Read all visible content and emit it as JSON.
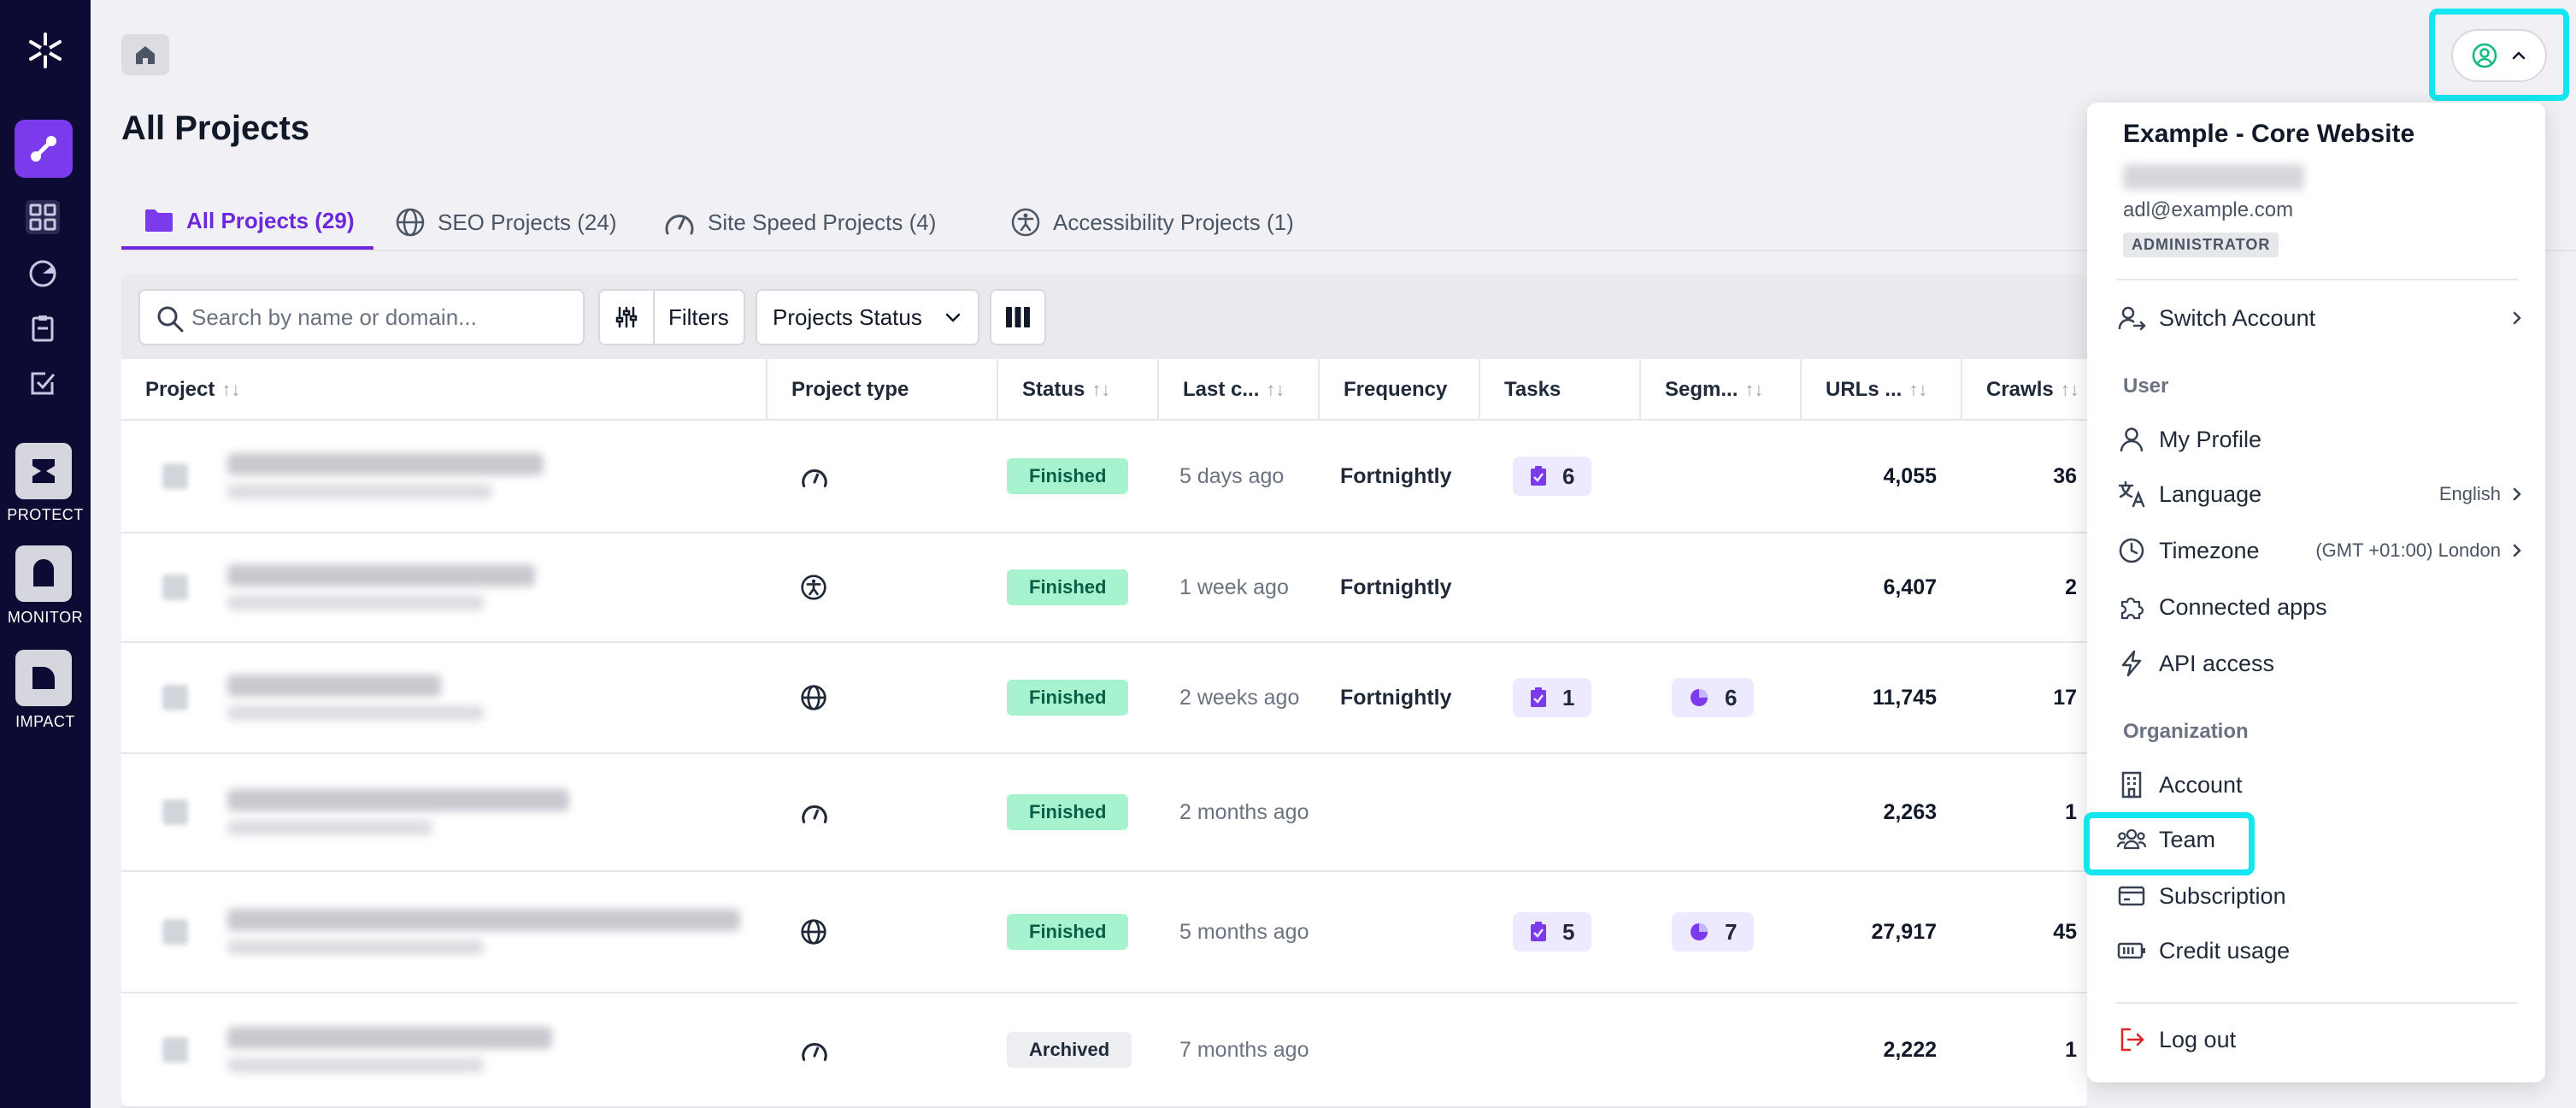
{
  "sidebar": {
    "apps": [
      {
        "label": "PROTECT"
      },
      {
        "label": "MONITOR"
      },
      {
        "label": "IMPACT"
      }
    ]
  },
  "page": {
    "title": "All Projects"
  },
  "tabs": [
    {
      "label": "All Projects (29)",
      "icon": "folder-icon",
      "active": true
    },
    {
      "label": "SEO Projects (24)",
      "icon": "globe-icon",
      "active": false
    },
    {
      "label": "Site Speed Projects (4)",
      "icon": "speedometer-icon",
      "active": false
    },
    {
      "label": "Accessibility Projects (1)",
      "icon": "accessibility-icon",
      "active": false
    }
  ],
  "toolbar": {
    "search_placeholder": "Search by name or domain...",
    "filters_label": "Filters",
    "status_label": "Projects Status"
  },
  "table": {
    "columns": {
      "project": "Project",
      "type": "Project type",
      "status": "Status",
      "last": "Last c...",
      "frequency": "Frequency",
      "tasks": "Tasks",
      "segments": "Segm...",
      "urls": "URLs ...",
      "crawls": "Crawls"
    },
    "sort_glyph": "↑↓",
    "rows": [
      {
        "type_icon": "speedometer-icon",
        "status": "Finished",
        "last": "5 days ago",
        "frequency": "Fortnightly",
        "tasks": "6",
        "segments": "",
        "urls": "4,055",
        "crawls": "36"
      },
      {
        "type_icon": "accessibility-icon",
        "status": "Finished",
        "last": "1 week ago",
        "frequency": "Fortnightly",
        "tasks": "",
        "segments": "",
        "urls": "6,407",
        "crawls": "2"
      },
      {
        "type_icon": "globe-icon",
        "status": "Finished",
        "last": "2 weeks ago",
        "frequency": "Fortnightly",
        "tasks": "1",
        "segments": "6",
        "urls": "11,745",
        "crawls": "17"
      },
      {
        "type_icon": "speedometer-icon",
        "status": "Finished",
        "last": "2 months ago",
        "frequency": "",
        "tasks": "",
        "segments": "",
        "urls": "2,263",
        "crawls": "1"
      },
      {
        "type_icon": "globe-icon",
        "status": "Finished",
        "last": "5 months ago",
        "frequency": "",
        "tasks": "5",
        "segments": "7",
        "urls": "27,917",
        "crawls": "45"
      },
      {
        "type_icon": "speedometer-icon",
        "status": "Archived",
        "last": "7 months ago",
        "frequency": "",
        "tasks": "",
        "segments": "",
        "urls": "2,222",
        "crawls": "1"
      }
    ]
  },
  "menu": {
    "account_name": "Example - Core Website",
    "email": "adl@example.com",
    "role": "ADMINISTRATOR",
    "switch_account": "Switch Account",
    "user_section": "User",
    "my_profile": "My Profile",
    "language": "Language",
    "language_value": "English",
    "timezone": "Timezone",
    "timezone_value": "(GMT +01:00) London",
    "connected_apps": "Connected apps",
    "api_access": "API access",
    "org_section": "Organization",
    "account": "Account",
    "team": "Team",
    "subscription": "Subscription",
    "credit_usage": "Credit usage",
    "log_out": "Log out"
  },
  "colors": {
    "accent": "#6d28d9",
    "sidebar_bg": "#0d0b33",
    "highlight": "#13e6f0",
    "success_bg": "#a7f3d0",
    "logout": "#dc2626"
  }
}
